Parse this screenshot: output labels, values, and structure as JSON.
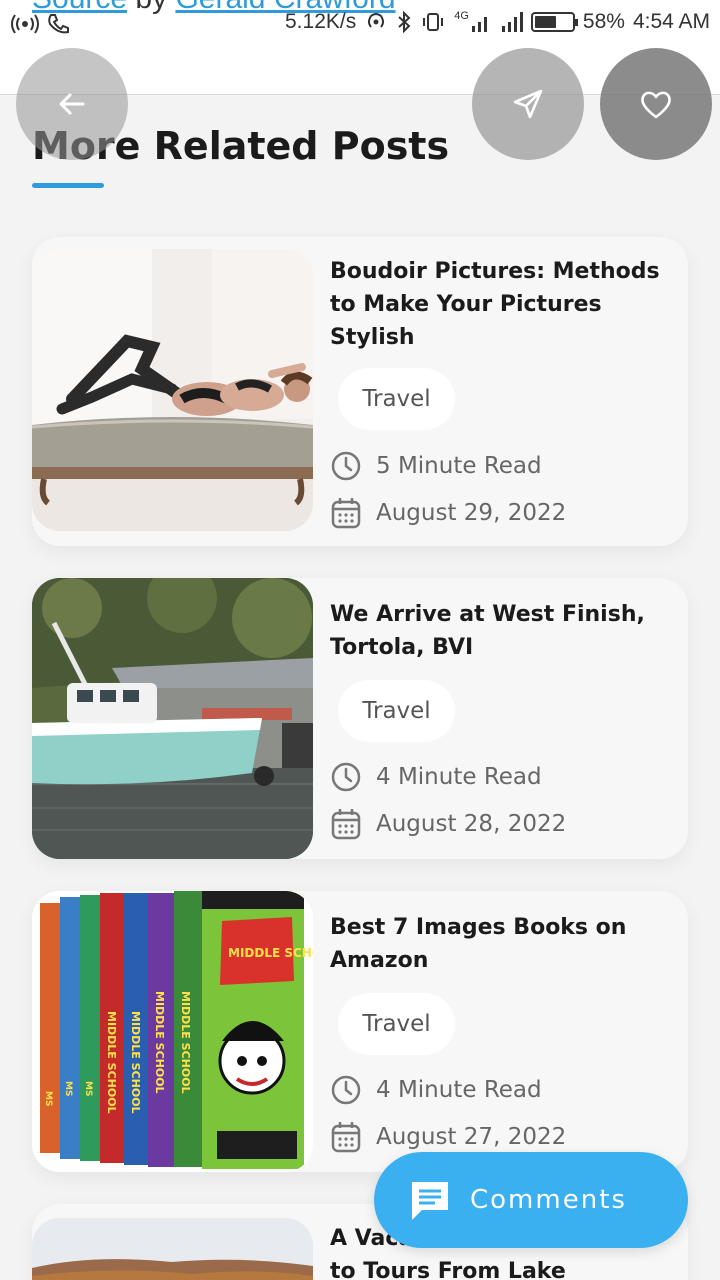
{
  "status_bar": {
    "behind_text": "Source",
    "behind_by": "by",
    "behind_author": "Gerald Crawford",
    "speed": "5.12K/s",
    "network": "4G",
    "battery": "58%",
    "battery_level": 0.58,
    "time": "4:54 AM"
  },
  "buttons": {
    "back_icon": "arrow-left-icon",
    "share_icon": "send-icon",
    "favorite_icon": "heart-icon"
  },
  "section": {
    "title": "More Related Posts",
    "accent_color": "#2e9bdc"
  },
  "posts": [
    {
      "title": "Boudoir Pictures: Methods to Make Your Pictures Stylish",
      "tag": "Travel",
      "read_time": "5 Minute Read",
      "date": "August 29, 2022"
    },
    {
      "title": "We Arrive at West Finish, Tortola, BVI",
      "tag": "Travel",
      "read_time": "4 Minute Read",
      "date": "August 28, 2022"
    },
    {
      "title": "Best 7 Images Books on Amazon",
      "tag": "Travel",
      "read_time": "4 Minute Read",
      "date": "August 27, 2022",
      "book_spine_text": "MIDDLE SCHOOL"
    },
    {
      "title": "A Vacation to Tours From Lake George,",
      "title_line1": "A Vaca",
      "title_line2": "to Tours From Lake George,"
    }
  ],
  "comments": {
    "label": "Comments",
    "color": "#3ab0f0"
  }
}
